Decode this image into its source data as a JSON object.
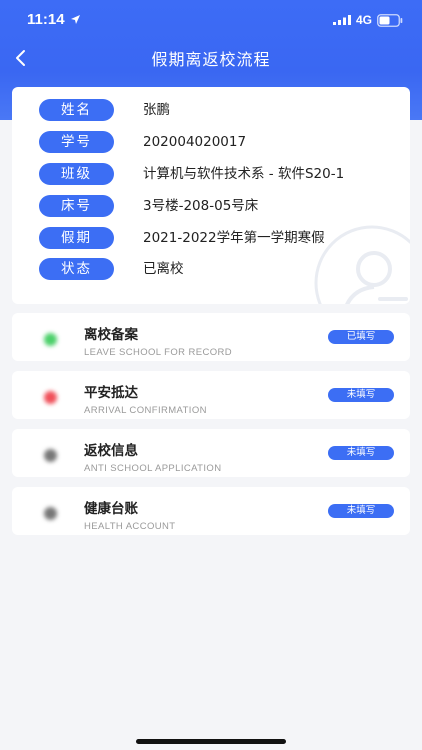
{
  "status_bar": {
    "time": "11:14",
    "network": "4G"
  },
  "nav": {
    "title": "假期离返校流程"
  },
  "info": {
    "rows": [
      {
        "label": "姓名",
        "value": "张鹏"
      },
      {
        "label": "学号",
        "value": "202004020017"
      },
      {
        "label": "班级",
        "value": "计算机与软件技术系 - 软件S20-1"
      },
      {
        "label": "床号",
        "value": "3号楼-208-05号床"
      },
      {
        "label": "假期",
        "value": "2021-2022学年第一学期寒假"
      },
      {
        "label": "状态",
        "value": "已离校"
      }
    ]
  },
  "steps": [
    {
      "title": "离校备案",
      "subtitle": "LEAVE SCHOOL FOR RECORD",
      "status": "已填写",
      "dot_color": "#4cd06a"
    },
    {
      "title": "平安抵达",
      "subtitle": "ARRIVAL CONFIRMATION",
      "status": "未填写",
      "dot_color": "#f0505a"
    },
    {
      "title": "返校信息",
      "subtitle": "ANTI SCHOOL APPLICATION",
      "status": "未填写",
      "dot_color": "#777777"
    },
    {
      "title": "健康台账",
      "subtitle": "HEALTH ACCOUNT",
      "status": "未填写",
      "dot_color": "#777777"
    }
  ],
  "colors": {
    "primary": "#3c6ef4",
    "header": "#3a67f2",
    "background": "#f4f5f8"
  }
}
